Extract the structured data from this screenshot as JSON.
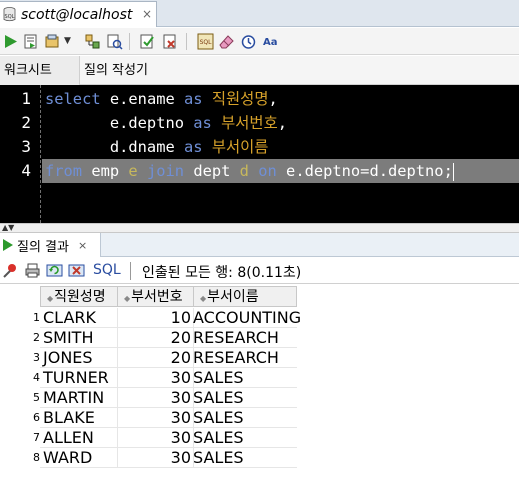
{
  "document_tab": {
    "title": "scott@localhost",
    "close": "×"
  },
  "sub_tabs": [
    "워크시트",
    "질의 작성기"
  ],
  "editor": {
    "line_numbers": [
      "1",
      "2",
      "3",
      "4"
    ]
  },
  "result_panel": {
    "tab_label": "질의 결과",
    "tab_close": "×",
    "sql_label": "SQL",
    "status": "인출된 모든 행: 8(0.11초)"
  },
  "grid": {
    "columns": [
      "직원성명",
      "부서번호",
      "부서이름"
    ],
    "rows": [
      {
        "n": "1",
        "ename": "CLARK",
        "deptno": "10",
        "dname": "ACCOUNTING"
      },
      {
        "n": "2",
        "ename": "SMITH",
        "deptno": "20",
        "dname": "RESEARCH"
      },
      {
        "n": "3",
        "ename": "JONES",
        "deptno": "20",
        "dname": "RESEARCH"
      },
      {
        "n": "4",
        "ename": "TURNER",
        "deptno": "30",
        "dname": "SALES"
      },
      {
        "n": "5",
        "ename": "MARTIN",
        "deptno": "30",
        "dname": "SALES"
      },
      {
        "n": "6",
        "ename": "BLAKE",
        "deptno": "30",
        "dname": "SALES"
      },
      {
        "n": "7",
        "ename": "ALLEN",
        "deptno": "30",
        "dname": "SALES"
      },
      {
        "n": "8",
        "ename": "WARD",
        "deptno": "30",
        "dname": "SALES"
      }
    ]
  },
  "colors": {
    "keyword": "#6f8fd6",
    "korean_alias": "#d6a12a",
    "table_alias": "#c7b85c",
    "editor_bg": "#000000",
    "selection": "#7c7c7c"
  }
}
